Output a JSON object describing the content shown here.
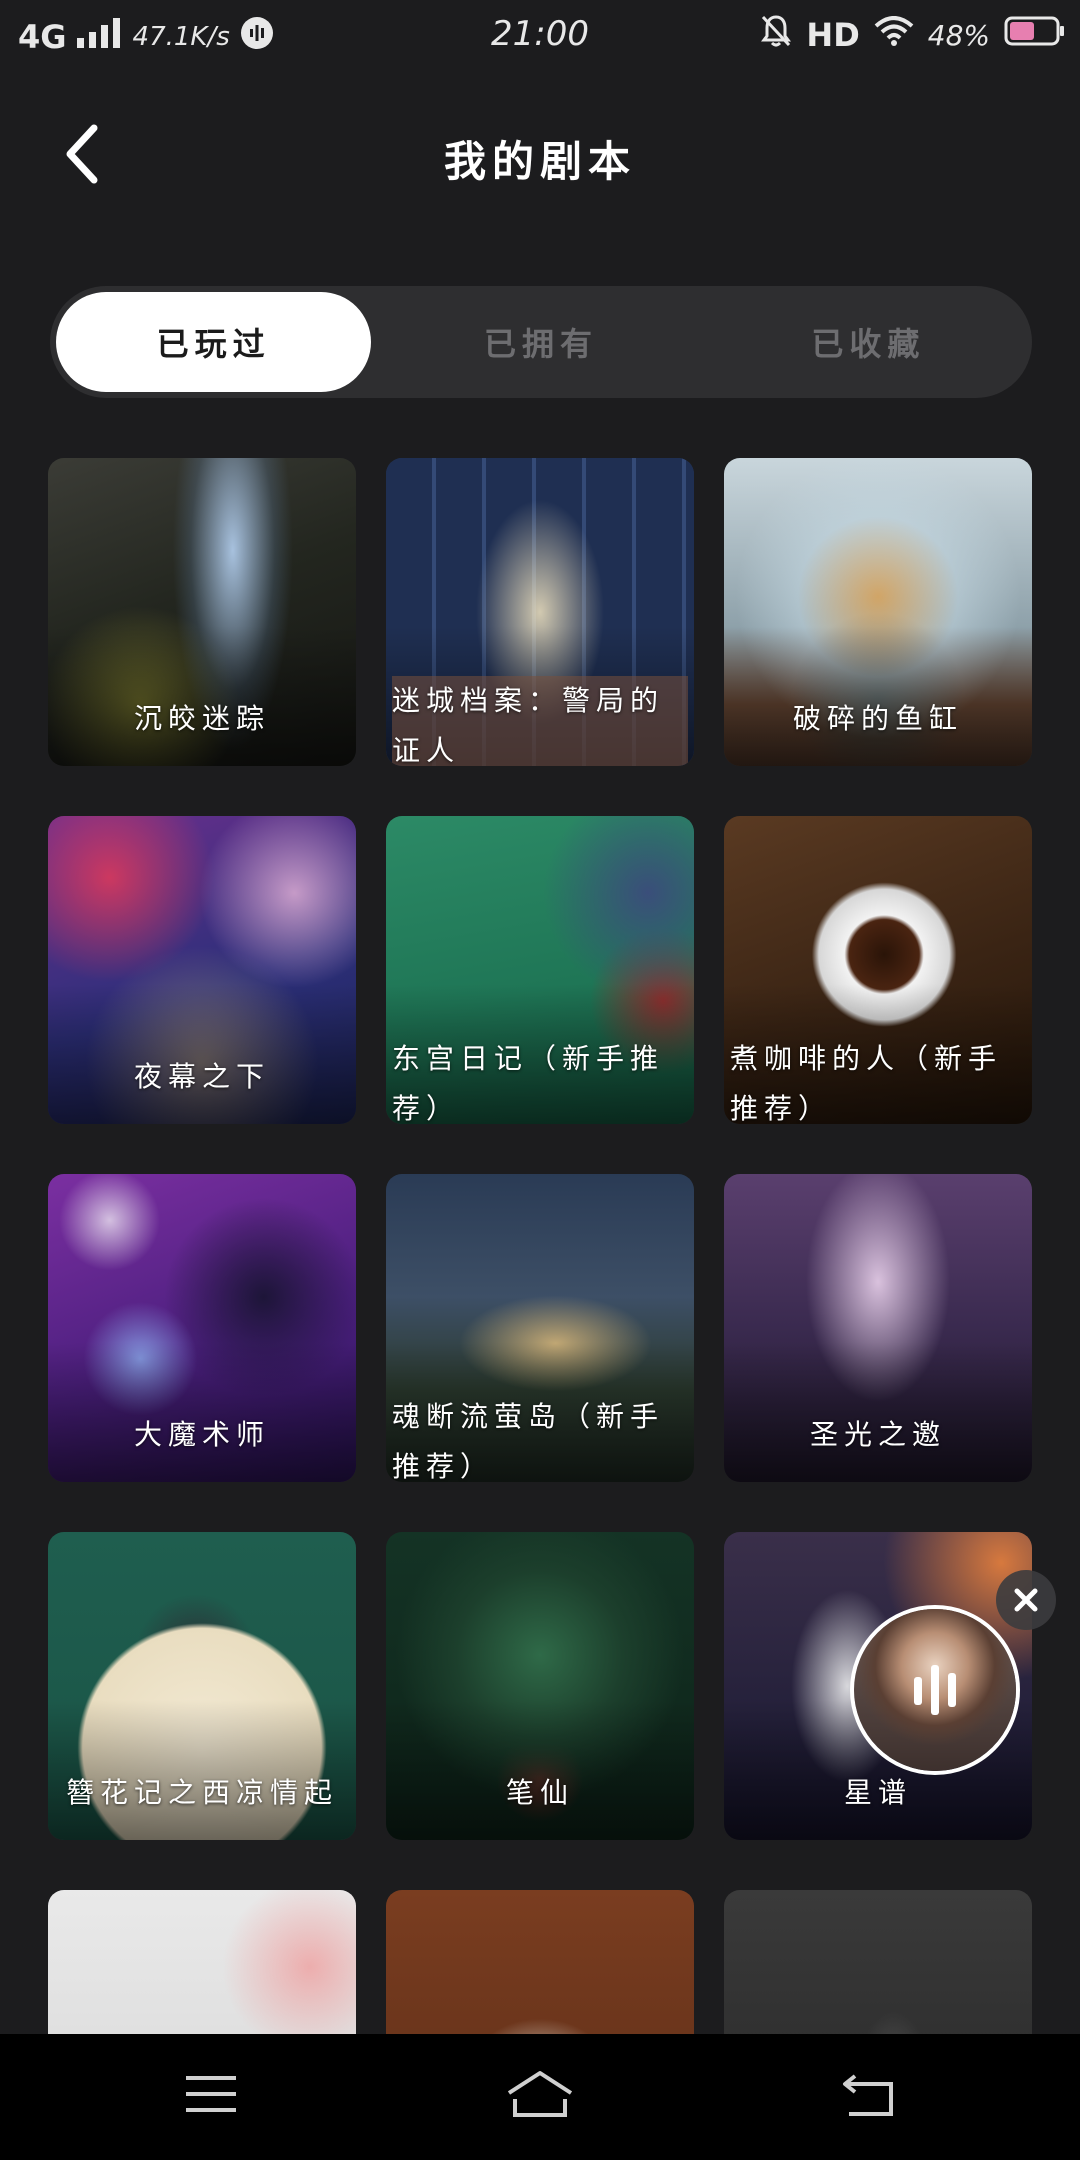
{
  "status_bar": {
    "network": "4G",
    "speed": "47.1K/s",
    "time": "21:00",
    "hd": "HD",
    "battery": "48%"
  },
  "header": {
    "title": "我的剧本"
  },
  "tabs": [
    {
      "label": "已玩过",
      "active": true
    },
    {
      "label": "已拥有",
      "active": false
    },
    {
      "label": "已收藏",
      "active": false
    }
  ],
  "scripts": [
    {
      "title": "沉皎迷踪"
    },
    {
      "title": "迷城档案：警局的证人"
    },
    {
      "title": "破碎的鱼缸"
    },
    {
      "title": "夜幕之下"
    },
    {
      "title": "东宫日记（新手推荐）"
    },
    {
      "title": "煮咖啡的人（新手推荐）"
    },
    {
      "title": "大魔术师"
    },
    {
      "title": "魂断流萤岛（新手推荐）"
    },
    {
      "title": "圣光之邀"
    },
    {
      "title": "簪花记之西凉情起"
    },
    {
      "title": "笔仙"
    },
    {
      "title": "星谱"
    },
    {
      "title": ""
    },
    {
      "title": ""
    },
    {
      "title": ""
    }
  ]
}
